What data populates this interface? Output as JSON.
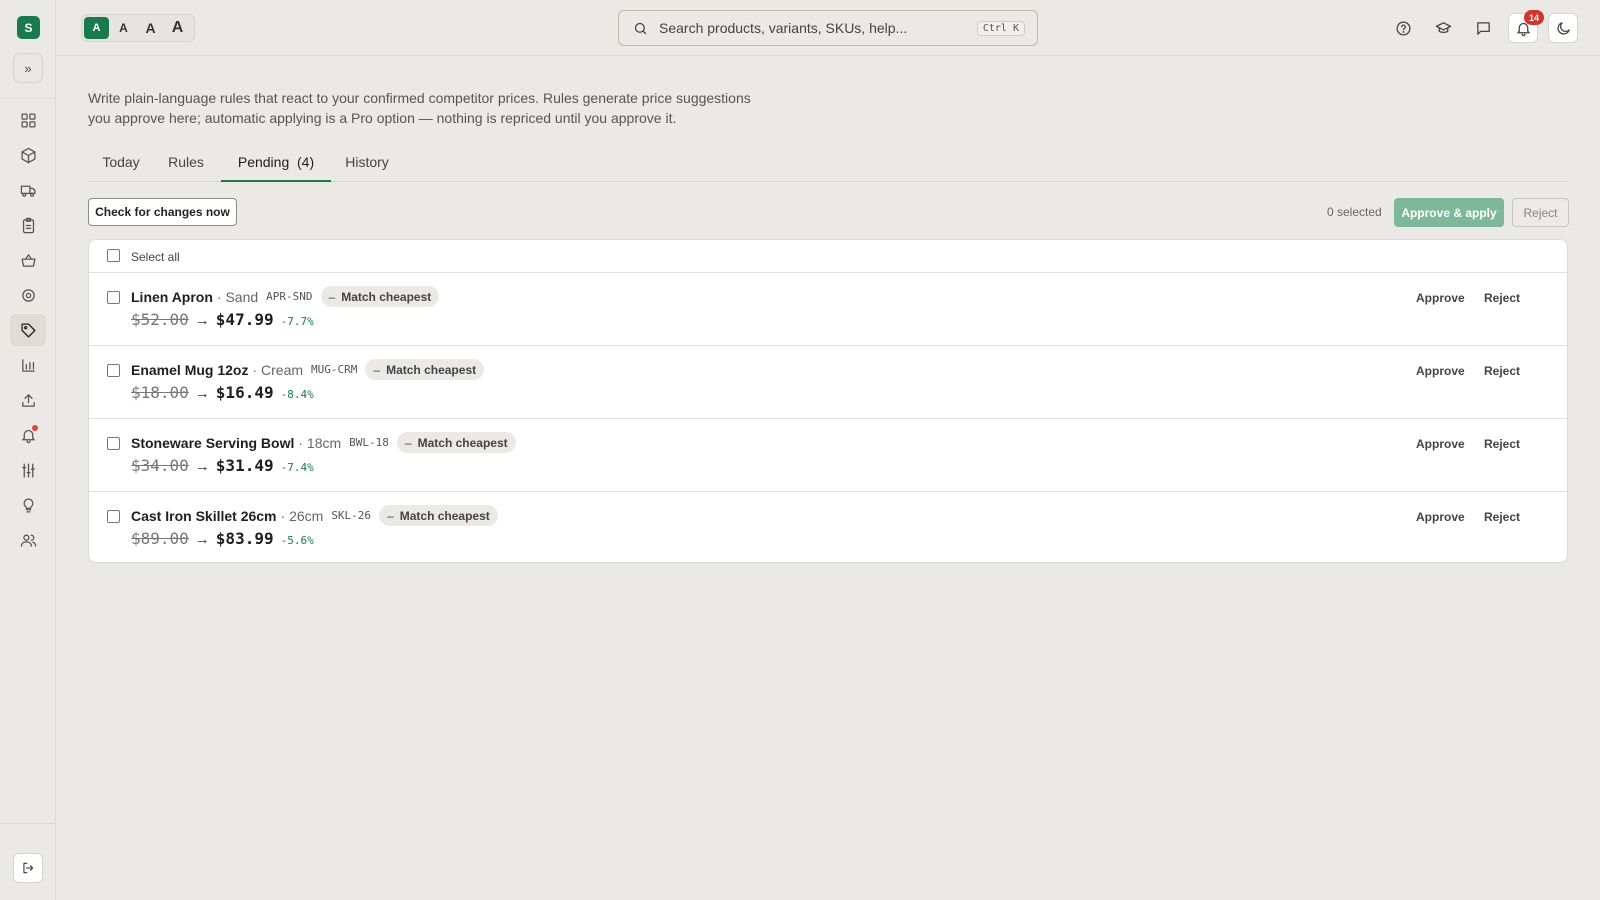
{
  "app": {
    "logo_letter": "S"
  },
  "sidebar": {
    "expand_icon": "chevrons-right-icon",
    "items": [
      {
        "icon": "grid-icon"
      },
      {
        "icon": "box-icon"
      },
      {
        "icon": "truck-icon"
      },
      {
        "icon": "clipboard-icon"
      },
      {
        "icon": "basket-icon"
      },
      {
        "icon": "target-icon"
      },
      {
        "icon": "tag-icon",
        "active": true
      },
      {
        "icon": "bar-chart-icon"
      },
      {
        "icon": "upload-icon"
      },
      {
        "icon": "bell-icon",
        "dot": true
      },
      {
        "icon": "sliders-icon"
      },
      {
        "icon": "lightbulb-icon"
      },
      {
        "icon": "users-icon"
      }
    ],
    "logout_icon": "logout-icon"
  },
  "topbar": {
    "font_sizes": [
      "A",
      "A",
      "A",
      "A"
    ],
    "search_placeholder": "Search products, variants, SKUs, help...",
    "search_shortcut": "Ctrl K",
    "notification_count": "14"
  },
  "main": {
    "intro_line1": "Write plain-language rules that react to your confirmed competitor prices. Rules generate price suggestions",
    "intro_line2": "you approve here; automatic applying is a Pro option — nothing is repriced until you approve it.",
    "tabs": [
      {
        "label": "Today"
      },
      {
        "label": "Rules"
      },
      {
        "label": "Pending  (4)",
        "active": true
      },
      {
        "label": "History"
      }
    ],
    "check_button": "Check for changes now",
    "selected_count": "0 selected",
    "approve_apply": "Approve & apply",
    "reject": "Reject",
    "select_all": "Select all",
    "rows": [
      {
        "name": "Linen Apron",
        "variant": "· Sand",
        "sku": "APR-SND",
        "rule": "Match cheapest",
        "old": "$52.00",
        "new": "$47.99",
        "pct": "-7.7%",
        "approve": "Approve",
        "reject": "Reject"
      },
      {
        "name": "Enamel Mug 12oz",
        "variant": "· Cream",
        "sku": "MUG-CRM",
        "rule": "Match cheapest",
        "old": "$18.00",
        "new": "$16.49",
        "pct": "-8.4%",
        "approve": "Approve",
        "reject": "Reject"
      },
      {
        "name": "Stoneware Serving Bowl",
        "variant": "· 18cm",
        "sku": "BWL-18",
        "rule": "Match cheapest",
        "old": "$34.00",
        "new": "$31.49",
        "pct": "-7.4%",
        "approve": "Approve",
        "reject": "Reject"
      },
      {
        "name": "Cast Iron Skillet 26cm",
        "variant": "· 26cm",
        "sku": "SKL-26",
        "rule": "Match cheapest",
        "old": "$89.00",
        "new": "$83.99",
        "pct": "-5.6%",
        "approve": "Approve",
        "reject": "Reject"
      }
    ],
    "rule_chip_dash": "–",
    "price_arrow": "→"
  },
  "colors": {
    "accent": "#1a7a4e",
    "badge": "#d6332b",
    "background": "#ebe9e5"
  }
}
